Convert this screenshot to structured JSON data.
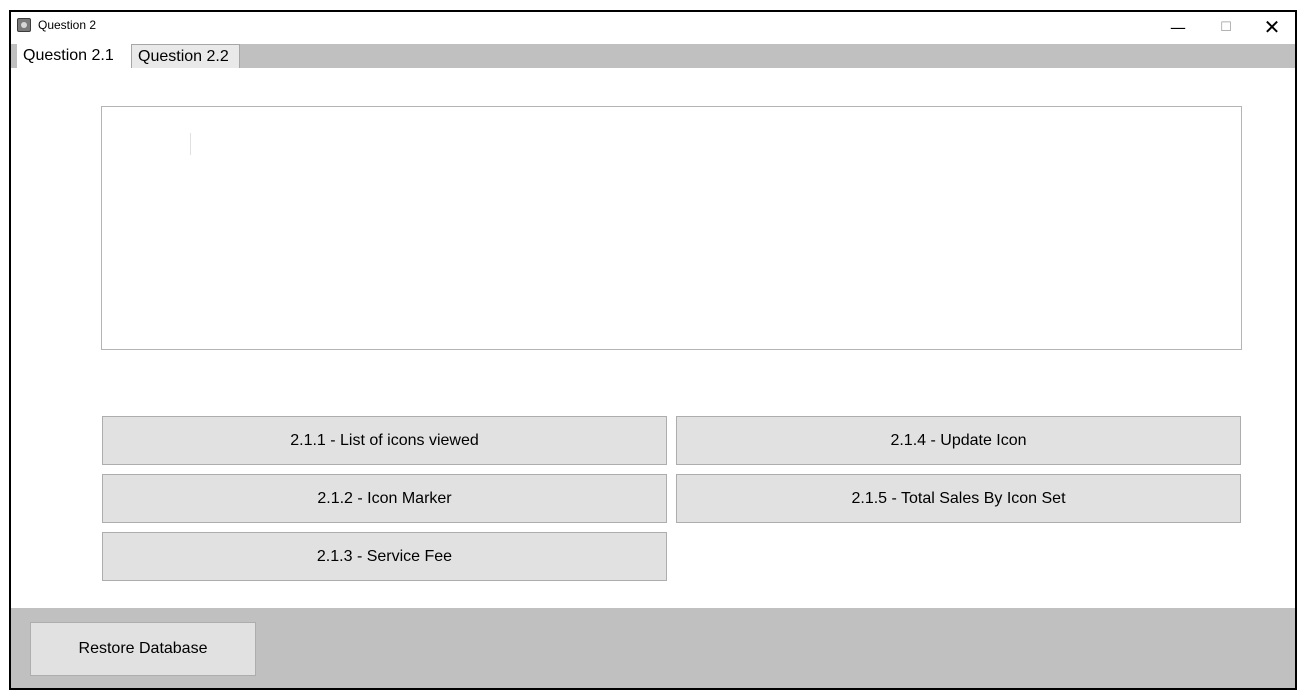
{
  "window": {
    "title": "Question 2",
    "app_icon": "application-icon",
    "controls": {
      "minimize": "—",
      "maximize": "☐",
      "close": "✕"
    }
  },
  "tabs": [
    {
      "label": "Question 2.1",
      "selected": true
    },
    {
      "label": "Question 2.2",
      "selected": false
    }
  ],
  "output": {
    "text": ""
  },
  "buttons": {
    "b211": "2.1.1 - List of icons viewed",
    "b212": "2.1.2 - Icon Marker",
    "b213": "2.1.3 - Service Fee",
    "b214": "2.1.4 - Update Icon",
    "b215": "2.1.5 - Total Sales By Icon Set"
  },
  "footer": {
    "restore_label": "Restore Database"
  },
  "colors": {
    "panel_gray": "#c0c0c0",
    "button_face": "#e1e1e1",
    "button_border": "#adadad"
  }
}
